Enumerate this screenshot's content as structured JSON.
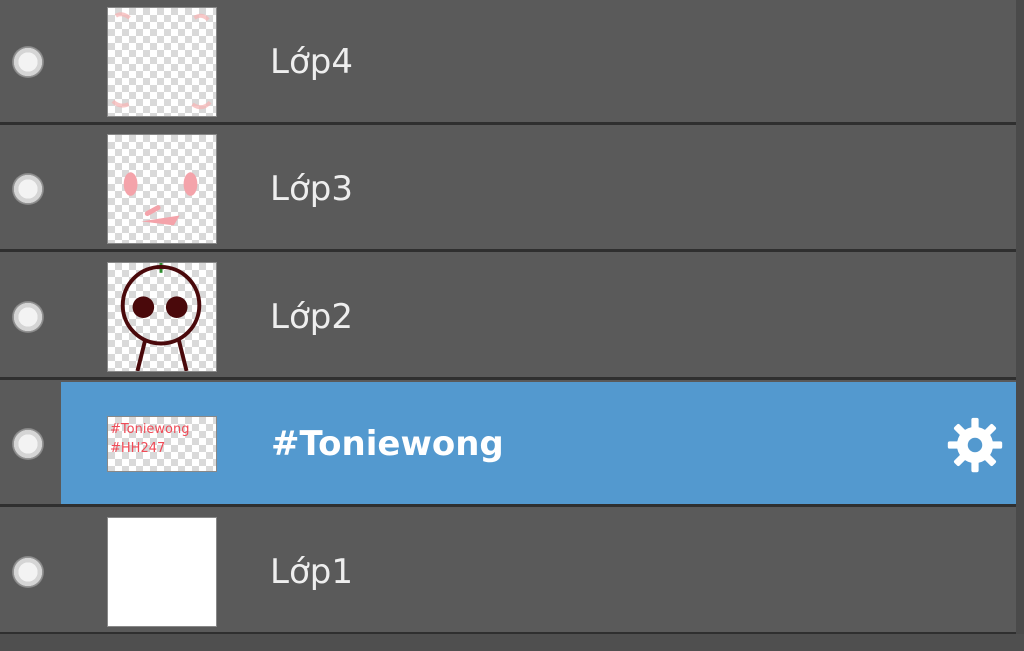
{
  "layers": [
    {
      "label": "Lớp4",
      "thumb_icon": "transparent-sketch-icon"
    },
    {
      "label": "Lớp3",
      "thumb_icon": "pink-face-marks-icon"
    },
    {
      "label": "Lớp2",
      "thumb_icon": "character-outline-icon"
    },
    {
      "label": "#Toniewong",
      "thumb_caption": "#Toniewong\n#HH247",
      "selected": true,
      "settings_icon": "gear-icon"
    },
    {
      "label": "Lớp1",
      "thumb_icon": "white-fill-icon"
    }
  ],
  "colors": {
    "panel": "#5a5a5a",
    "divider": "#2f2f2f",
    "selected": "#5399cf",
    "label": "#eeeeee",
    "thumbnail_text": "#f04b57"
  }
}
